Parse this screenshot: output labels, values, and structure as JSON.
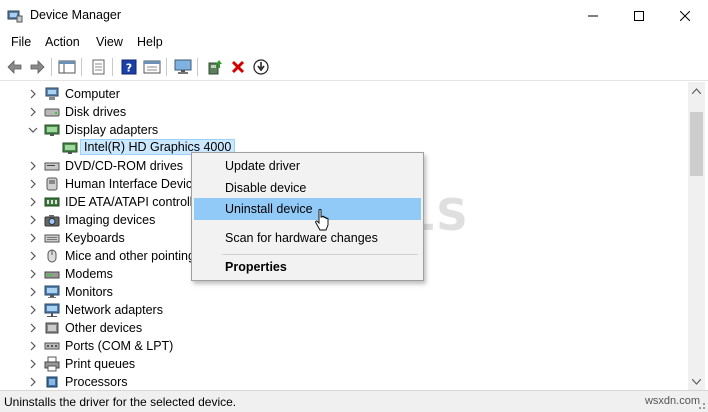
{
  "window": {
    "title": "Device Manager"
  },
  "menu": [
    "File",
    "Action",
    "View",
    "Help"
  ],
  "toolbar": {
    "icons": [
      "back-arrow-icon",
      "forward-arrow-icon",
      "show-hide-icon",
      "properties-icon",
      "help-icon",
      "details-icon",
      "monitor-icon",
      "update-driver-icon",
      "uninstall-icon",
      "download-icon"
    ]
  },
  "tree": {
    "items": [
      {
        "label": "Computer",
        "icon": "computer-icon",
        "expanded": false
      },
      {
        "label": "Disk drives",
        "icon": "disk-icon",
        "expanded": false
      },
      {
        "label": "Display adapters",
        "icon": "display-icon",
        "expanded": true
      },
      {
        "label": "Intel(R) HD Graphics 4000",
        "icon": "display-device-icon",
        "child": true,
        "selected": true
      },
      {
        "label": "DVD/CD-ROM drives",
        "icon": "dvd-icon",
        "expanded": false
      },
      {
        "label": "Human Interface Device",
        "icon": "hid-icon",
        "expanded": false
      },
      {
        "label": "IDE ATA/ATAPI controlle",
        "icon": "ide-icon",
        "expanded": false
      },
      {
        "label": "Imaging devices",
        "icon": "camera-icon",
        "expanded": false
      },
      {
        "label": "Keyboards",
        "icon": "keyboard-icon",
        "expanded": false
      },
      {
        "label": "Mice and other pointing",
        "icon": "mouse-icon",
        "expanded": false
      },
      {
        "label": "Modems",
        "icon": "modem-icon",
        "expanded": false
      },
      {
        "label": "Monitors",
        "icon": "monitor-icon",
        "expanded": false
      },
      {
        "label": "Network adapters",
        "icon": "network-icon",
        "expanded": false
      },
      {
        "label": "Other devices",
        "icon": "other-devices-icon",
        "expanded": false
      },
      {
        "label": "Ports (COM & LPT)",
        "icon": "port-icon",
        "expanded": false
      },
      {
        "label": "Print queues",
        "icon": "printer-icon",
        "expanded": false
      },
      {
        "label": "Processors",
        "icon": "processor-icon",
        "expanded": false
      }
    ]
  },
  "context_menu": {
    "items": [
      {
        "label": "Update driver"
      },
      {
        "label": "Disable device"
      },
      {
        "label": "Uninstall device",
        "hover": true
      },
      {
        "label": "Scan for hardware changes"
      },
      {
        "label": "Properties",
        "bold": true
      }
    ]
  },
  "status": {
    "text": "Uninstalls the driver for the selected device.",
    "watermark": "wsxdn.com"
  },
  "watermark_text": "A  PUALS",
  "colors": {
    "selection": "#cce8ff",
    "menu_hover": "#91c9f7",
    "uninstall_red": "#d40000",
    "help_blue": "#1a3fa8"
  }
}
